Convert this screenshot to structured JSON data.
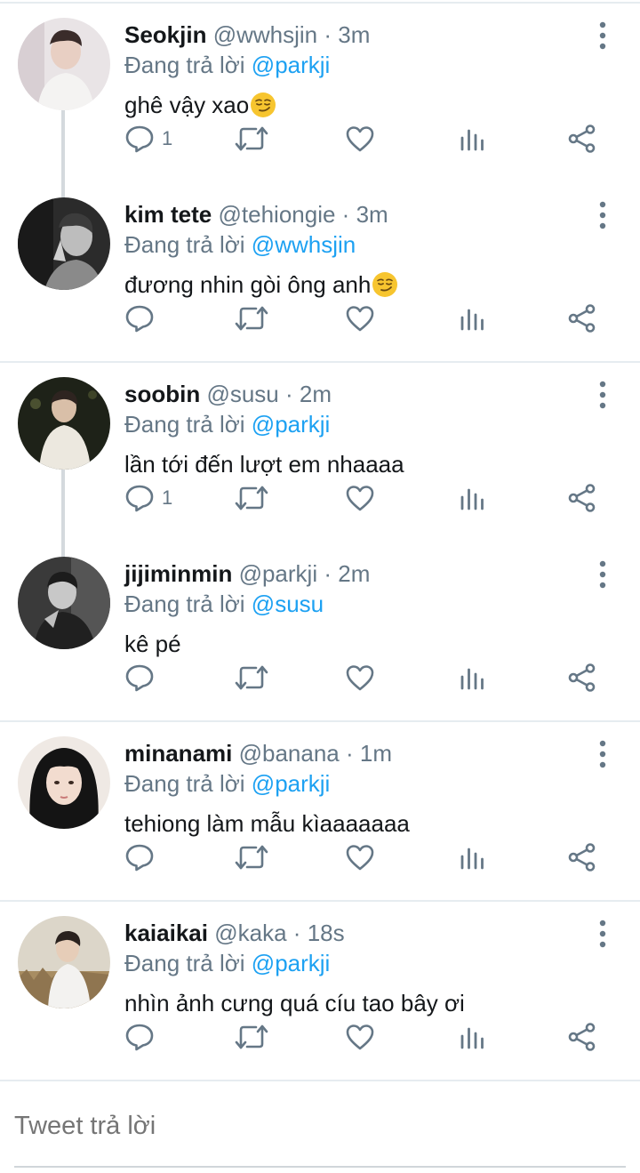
{
  "reply_prefix": "Đang trả lời",
  "tweets": [
    {
      "name": "Seokjin",
      "handle": "@wwhsjin",
      "time": "3m",
      "reply_to": "@parkji",
      "text": "ghê vậy xao",
      "emoji": "smirk",
      "reply_count": "1"
    },
    {
      "name": "kim tete",
      "handle": "@tehiongie",
      "time": "3m",
      "reply_to": "@wwhsjin",
      "text": "đương nhin gòi ông anh",
      "emoji": "smirk",
      "reply_count": ""
    },
    {
      "name": "soobin",
      "handle": "@susu",
      "time": "2m",
      "reply_to": "@parkji",
      "text": "lần tới đến lượt em nhaaaa",
      "emoji": "",
      "reply_count": "1"
    },
    {
      "name": "jijiminmin",
      "handle": "@parkji",
      "time": "2m",
      "reply_to": "@susu",
      "text": "kê pé",
      "emoji": "",
      "reply_count": ""
    },
    {
      "name": "minanami",
      "handle": "@banana",
      "time": "1m",
      "reply_to": "@parkji",
      "text": "tehiong làm mẫu kìaaaaaaa",
      "emoji": "",
      "reply_count": ""
    },
    {
      "name": "kaiaikai",
      "handle": "@kaka",
      "time": "18s",
      "reply_to": "@parkji",
      "text": "nhìn ảnh cưng quá cíu tao bây ơi",
      "emoji": "",
      "reply_count": ""
    }
  ],
  "composer": {
    "placeholder": "Tweet trả lời"
  },
  "colors": {
    "accent": "#1da1f2",
    "text": "#14171a",
    "secondary": "#657786",
    "icon": "#657786",
    "divider": "#e6ecf0",
    "thread": "#d4d9dd"
  },
  "icons": [
    "reply-icon",
    "retweet-icon",
    "like-icon",
    "analytics-icon",
    "share-icon",
    "more-vertical-icon",
    "smirk-emoji"
  ]
}
